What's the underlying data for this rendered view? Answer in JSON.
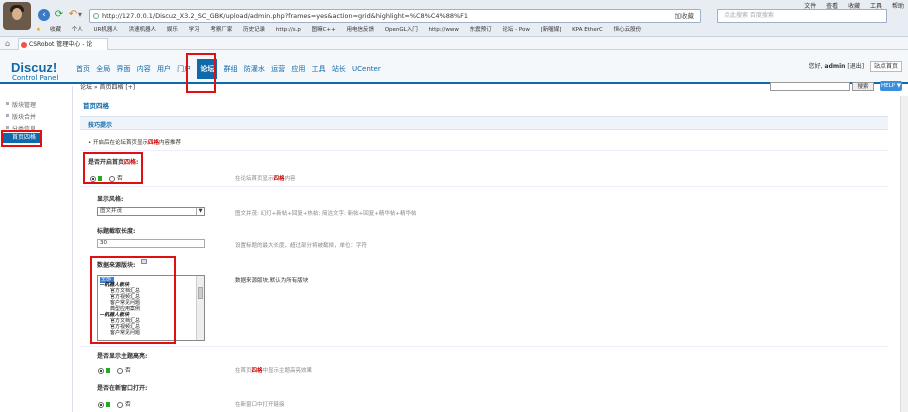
{
  "browser": {
    "url": "http://127.0.0.1/Discuz_X3.2_SC_GBK/upload/admin.php?frames=yes&action=grid&highlight=%C8%C4%88%F1",
    "search_placeholder": "点此搜索 百度搜索",
    "addr_fav": "加收藏",
    "menu": [
      "文件",
      "查看",
      "收藏",
      "工具",
      "帮助"
    ],
    "bookmarks": [
      "收藏",
      "个人",
      "UR机器人",
      "洪速机器人",
      "娱乐",
      "学习",
      "考察厂家",
      "历史记录",
      "http://s.p",
      "图嘛C++",
      "用电信反馈",
      "OpenGL入门",
      "http://www",
      "东震预订",
      "论坛 - Pow",
      "[新喔媒]",
      "KPA EtherC",
      "恒心云股份"
    ],
    "tab_label": "CSRobot 管理中心 - 论"
  },
  "header": {
    "logo": "Discuz!",
    "logo_sub": "Control Panel",
    "nav": [
      "首页",
      "全局",
      "界面",
      "内容",
      "用户",
      "门户",
      "论坛",
      "群组",
      "防灌水",
      "运营",
      "应用",
      "工具",
      "站长",
      "UCenter"
    ],
    "active_nav": "论坛",
    "greeting": "您好,",
    "username": "admin",
    "logout": "[退出]",
    "site_home": "站点首页"
  },
  "sidebar": {
    "items": [
      "版块管理",
      "版块合并",
      "分类信息",
      "首页四格"
    ],
    "current": "首页四格"
  },
  "breadcrumb": {
    "text": "论坛 » 首页四格",
    "add": "[+]",
    "search_button": "搜索",
    "help_button": "HELP ▼"
  },
  "main": {
    "page_title": "首页四格",
    "section_title": "技巧提示",
    "tip_prefix": "开启后在论坛首页显示",
    "tip_highlight": "四格",
    "tip_suffix": "内容推荐",
    "fields": {
      "enable": {
        "label_prefix": "是否开启首页",
        "label_highlight": "四格",
        "label_suffix": ":",
        "yes": "是",
        "no": "否",
        "value": "是",
        "hint_prefix": "在论坛首页显示",
        "hint_highlight": "四格",
        "hint_suffix": "内容"
      },
      "style": {
        "label": "显示风格:",
        "value": "图文并茂",
        "hint": "图文并茂: 幻灯+新帖+回复+热帖; 简洁文字: 新帖+回复+精华帖+精华帖"
      },
      "title_length": {
        "label": "标题截取长度:",
        "value": "30",
        "hint": "设置标题的最大长度，超过部分将被截掉，单位：字符"
      },
      "source_forums": {
        "label": "数据来源版块:",
        "hint": "数据来源版块,默认为所有版块",
        "options": [
          {
            "text": "全部",
            "kind": "selected"
          },
          {
            "text": "--机器人板块",
            "kind": "group"
          },
          {
            "text": "官方文档汇总",
            "kind": "item"
          },
          {
            "text": "官方视频汇总",
            "kind": "item"
          },
          {
            "text": "客户常见问题",
            "kind": "item"
          },
          {
            "text": "典型应用案例",
            "kind": "item"
          },
          {
            "text": "--机器人板块",
            "kind": "group"
          },
          {
            "text": "官方文档汇总",
            "kind": "item"
          },
          {
            "text": "官方视频汇总",
            "kind": "item"
          },
          {
            "text": "客户常见问题",
            "kind": "item"
          }
        ]
      },
      "show_highlight": {
        "label": "是否显示主题高亮:",
        "yes": "是",
        "no": "否",
        "value": "是",
        "hint_prefix": "在首页",
        "hint_highlight": "四格",
        "hint_suffix": "中显示主题高亮效果"
      },
      "new_window": {
        "label": "是否在新窗口打开:",
        "yes": "是",
        "no": "否",
        "value": "是",
        "hint": "在新窗口中打开链接"
      }
    }
  },
  "colors": {
    "brand": "#0e6aab",
    "annotation": "#e01010",
    "highlight_text": "#cc0000"
  }
}
